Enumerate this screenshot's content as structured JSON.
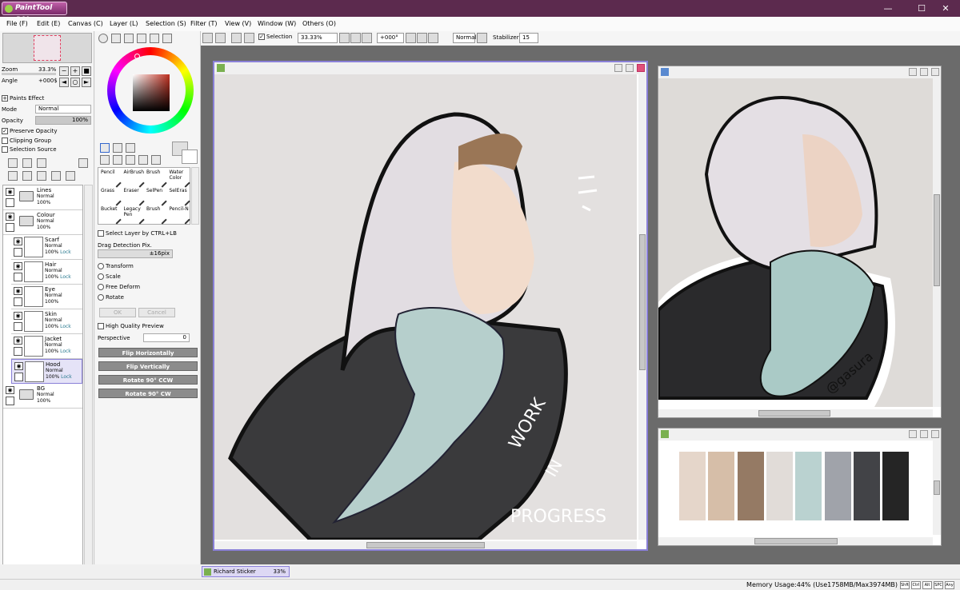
{
  "app": {
    "logo_text": "PaintTool SAI"
  },
  "window_controls": {
    "minimize": "—",
    "maximize": "☐",
    "close": "✕"
  },
  "menu": [
    "File (F)",
    "Edit (E)",
    "Canvas (C)",
    "Layer (L)",
    "Selection (S)",
    "Filter (T)",
    "View (V)",
    "Window (W)",
    "Others (O)"
  ],
  "navigator": {
    "zoom_label": "Zoom",
    "zoom_value": "33.3%",
    "angle_label": "Angle",
    "angle_value": "+000$"
  },
  "layer_props": {
    "paints_effect": "Paints Effect",
    "mode_label": "Mode",
    "mode_value": "Normal",
    "opacity_label": "Opacity",
    "opacity_value": "100%",
    "preserve_opacity": "Preserve Opacity",
    "clipping_group": "Clipping Group",
    "selection_source": "Selection Source"
  },
  "layers": [
    {
      "name": "Lines",
      "mode": "Normal",
      "opacity": "100%",
      "lock": "",
      "folder": true,
      "child": false,
      "selected": false
    },
    {
      "name": "Colour",
      "mode": "Normal",
      "opacity": "100%",
      "lock": "",
      "folder": true,
      "child": false,
      "selected": false
    },
    {
      "name": "Scarf",
      "mode": "Normal",
      "opacity": "100%",
      "lock": "Lock",
      "folder": false,
      "child": true,
      "selected": false
    },
    {
      "name": "Hair",
      "mode": "Normal",
      "opacity": "100%",
      "lock": "Lock",
      "folder": false,
      "child": true,
      "selected": false
    },
    {
      "name": "Eye",
      "mode": "Normal",
      "opacity": "100%",
      "lock": "",
      "folder": false,
      "child": true,
      "selected": false
    },
    {
      "name": "Skin",
      "mode": "Normal",
      "opacity": "100%",
      "lock": "Lock",
      "folder": false,
      "child": true,
      "selected": false
    },
    {
      "name": "Jacket",
      "mode": "Normal",
      "opacity": "100%",
      "lock": "Lock",
      "folder": false,
      "child": true,
      "selected": false
    },
    {
      "name": "Hood",
      "mode": "Normal",
      "opacity": "100%",
      "lock": "Lock",
      "folder": false,
      "child": true,
      "selected": true
    },
    {
      "name": "BG",
      "mode": "Normal",
      "opacity": "100%",
      "lock": "",
      "folder": true,
      "child": false,
      "selected": false
    }
  ],
  "tools": [
    {
      "name": "Pencil"
    },
    {
      "name": "AirBrush"
    },
    {
      "name": "Brush"
    },
    {
      "name": "Water Color"
    },
    {
      "name": "Grass"
    },
    {
      "name": "Eraser"
    },
    {
      "name": "SelPen"
    },
    {
      "name": "SelEras"
    },
    {
      "name": "Bucket"
    },
    {
      "name": "Legacy Pen"
    },
    {
      "name": "Brush"
    },
    {
      "name": "Pencil-N"
    }
  ],
  "transform": {
    "select_layer": "Select Layer by CTRL+LB",
    "drag_detection_label": "Drag Detection Pix.",
    "drag_detection_value": "±16pix",
    "options": [
      "Transform",
      "Scale",
      "Free Deform",
      "Rotate"
    ],
    "ok": "OK",
    "cancel": "Cancel",
    "hq_preview": "High Quality Preview",
    "perspective_label": "Perspective",
    "perspective_value": "0",
    "buttons": [
      "Flip Horizontally",
      "Flip Vertically",
      "Rotate 90° CCW",
      "Rotate 90° CW"
    ]
  },
  "canvas_toolbar": {
    "selection": "Selection",
    "zoom": "33.33%",
    "angle": "+000°",
    "blend": "Normal",
    "stabilizer_label": "Stabilizer",
    "stabilizer_value": "15"
  },
  "artwork": {
    "wip_line1": "WORK",
    "wip_line2": "IN",
    "wip_line3": "PROGRESS",
    "signature": "@gasura"
  },
  "palette": [
    "#e5d6ca",
    "#d6bea8",
    "#957a64",
    "#e1dcd8",
    "#bad2d0",
    "#a0a3aa",
    "#424347",
    "#252525"
  ],
  "colors": {
    "titlebar": "#5c2a4e",
    "selected_layer": "#e5e3f7",
    "accent": "#8a80d8"
  },
  "document_tab": {
    "name": "Richard Sticker",
    "zoom": "33%"
  },
  "status": {
    "memory": "Memory Usage:44% (Use1758MB/Max3974MB)",
    "keys": [
      "Shft",
      "Ctrl",
      "Alt",
      "SPC",
      "Any"
    ]
  }
}
